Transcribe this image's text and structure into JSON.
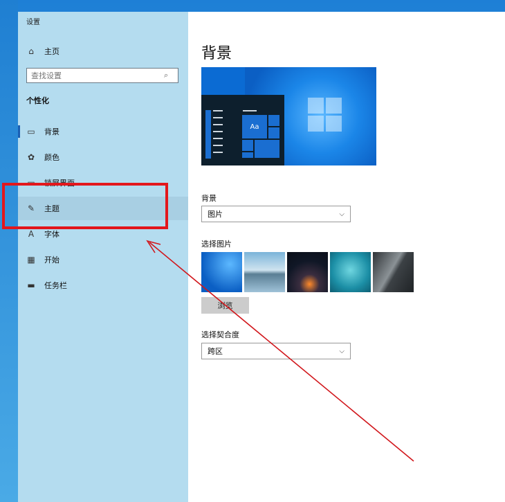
{
  "window": {
    "title": "设置"
  },
  "sidebar": {
    "home_label": "主页",
    "search_placeholder": "查找设置",
    "section": "个性化",
    "items": [
      {
        "label": "背景",
        "icon": "image-icon",
        "selected": true
      },
      {
        "label": "颜色",
        "icon": "palette-icon"
      },
      {
        "label": "锁屏界面",
        "icon": "lock-screen-icon"
      },
      {
        "label": "主题",
        "icon": "brush-icon",
        "hovered": true
      },
      {
        "label": "字体",
        "icon": "font-icon"
      },
      {
        "label": "开始",
        "icon": "start-icon"
      },
      {
        "label": "任务栏",
        "icon": "taskbar-icon"
      }
    ]
  },
  "main": {
    "title": "背景",
    "preview_tile_text": "Aa",
    "background_label": "背景",
    "background_value": "图片",
    "choose_picture_label": "选择图片",
    "browse_label": "浏览",
    "fit_label": "选择契合度",
    "fit_value": "跨区"
  },
  "annotation": {
    "box_color": "#e3171c",
    "arrow_color": "#d1161b"
  }
}
